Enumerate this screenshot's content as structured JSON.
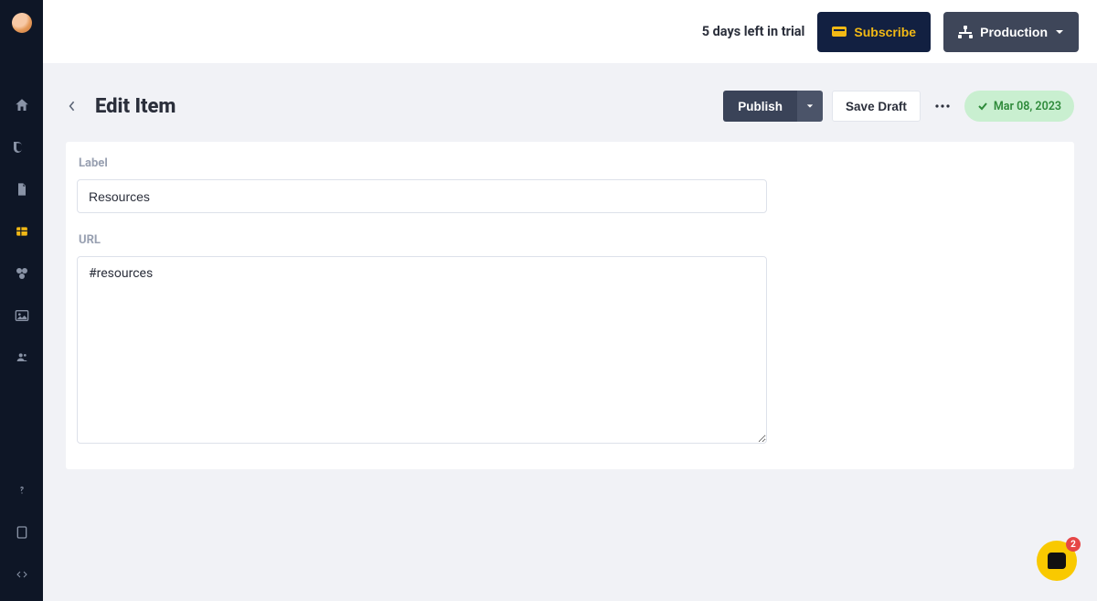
{
  "topbar": {
    "trial_text": "5 days left in trial",
    "subscribe_label": "Subscribe",
    "env_label": "Production"
  },
  "sidebar": {
    "icons": [
      "home",
      "blog",
      "page",
      "collection",
      "plugins",
      "media",
      "users",
      "help",
      "docs",
      "code"
    ]
  },
  "page": {
    "title": "Edit Item",
    "publish_label": "Publish",
    "save_draft_label": "Save Draft",
    "status_date": "Mar 08, 2023"
  },
  "form": {
    "label_heading": "Label",
    "label_value": "Resources",
    "url_heading": "URL",
    "url_value": "#resources"
  },
  "chat": {
    "unread": "2"
  }
}
